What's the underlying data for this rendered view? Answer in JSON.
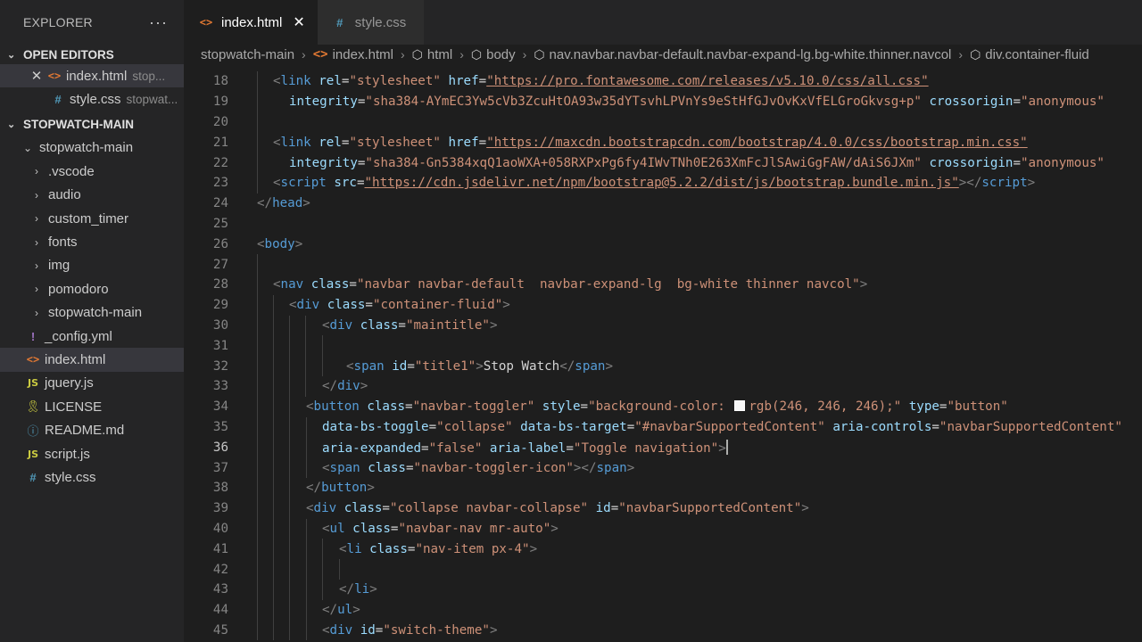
{
  "explorer": {
    "title": "EXPLORER",
    "more": "···",
    "open_editors": {
      "label": "OPEN EDITORS",
      "items": [
        {
          "name": "index.html",
          "sub": "stop..."
        },
        {
          "name": "style.css",
          "sub": "stopwat..."
        }
      ]
    },
    "workspace": {
      "label": "STOPWATCH-MAIN",
      "folder": "stopwatch-main",
      "items": [
        ".vscode",
        "audio",
        "custom_timer",
        "fonts",
        "img",
        "pomodoro",
        "stopwatch-main",
        "_config.yml",
        "index.html",
        "jquery.js",
        "LICENSE",
        "README.md",
        "script.js",
        "style.css"
      ]
    }
  },
  "tabs": [
    {
      "label": "index.html",
      "close": "✕"
    },
    {
      "label": "style.css"
    }
  ],
  "breadcrumb": [
    "stopwatch-main",
    "index.html",
    "html",
    "body",
    "nav.navbar.navbar-default.navbar-expand-lg.bg-white.thinner.navcol",
    "div.container-fluid"
  ],
  "editor": {
    "current_line": 36,
    "lines": [
      {
        "n": "18",
        "p1": "<",
        "t1": "link",
        "a1": " rel",
        "e1": "=",
        "s1": "\"stylesheet\"",
        "a2": " href",
        "e2": "=",
        "s2": "\"https://pro.fontawesome.com/releases/v5.10.0/css/all.css\""
      },
      {
        "n": "19",
        "a1": "integrity",
        "e1": "=",
        "s1": "\"sha384-AYmEC3Yw5cVb3ZcuHtOA93w35dYTsvhLPVnYs9eStHfGJvOvKxVfELGroGkvsg+p\"",
        "a2": " crossorigin",
        "e2": "=",
        "s2": "\"anonymous\""
      },
      {
        "n": "20"
      },
      {
        "n": "21",
        "p1": "<",
        "t1": "link",
        "a1": " rel",
        "e1": "=",
        "s1": "\"stylesheet\"",
        "a2": " href",
        "e2": "=",
        "s2": "\"https://maxcdn.bootstrapcdn.com/bootstrap/4.0.0/css/bootstrap.min.css\""
      },
      {
        "n": "22",
        "a1": "integrity",
        "e1": "=",
        "s1": "\"sha384-Gn5384xqQ1aoWXA+058RXPxPg6fy4IWvTNh0E263XmFcJlSAwiGgFAW/dAiS6JXm\"",
        "a2": " crossorigin",
        "e2": "=",
        "s2": "\"anonymous\""
      },
      {
        "n": "23",
        "p1": "<",
        "t1": "script",
        "a1": " src",
        "e1": "=",
        "s1": "\"https://cdn.jsdelivr.net/npm/bootstrap@5.2.2/dist/js/bootstrap.bundle.min.js\"",
        "p2": "></",
        "t2": "script",
        "p3": ">"
      },
      {
        "n": "24",
        "p1": "</",
        "t1": "head",
        "p2": ">"
      },
      {
        "n": "25"
      },
      {
        "n": "26",
        "p1": "<",
        "t1": "body",
        "p2": ">"
      },
      {
        "n": "27"
      },
      {
        "n": "28",
        "p1": "<",
        "t1": "nav",
        "a1": " class",
        "e1": "=",
        "s1": "\"navbar navbar-default  navbar-expand-lg  bg-white thinner navcol\"",
        "p2": ">"
      },
      {
        "n": "29",
        "p1": "<",
        "t1": "div",
        "a1": " class",
        "e1": "=",
        "s1": "\"container-fluid\"",
        "p2": ">"
      },
      {
        "n": "30",
        "p1": "<",
        "t1": "div",
        "a1": " class",
        "e1": "=",
        "s1": "\"maintitle\"",
        "p2": ">"
      },
      {
        "n": "31"
      },
      {
        "n": "32",
        "p1": "<",
        "t1": "span",
        "a1": " id",
        "e1": "=",
        "s1": "\"title1\"",
        "p2": ">",
        "x1": "Stop Watch",
        "p3": "</",
        "t2": "span",
        "p4": ">"
      },
      {
        "n": "33",
        "p1": "</",
        "t1": "div",
        "p2": ">"
      },
      {
        "n": "34",
        "p1": "<",
        "t1": "button",
        "a1": " class",
        "e1": "=",
        "s1": "\"navbar-toggler\"",
        "a2": " style",
        "e2": "=",
        "s2a": "\"background-color: ",
        "s2b": "rgb(246, 246, 246);\"",
        "a3": " type",
        "e3": "=",
        "s3": "\"button\""
      },
      {
        "n": "35",
        "a1": "data-bs-toggle",
        "e1": "=",
        "s1": "\"collapse\"",
        "a2": " data-bs-target",
        "e2": "=",
        "s2": "\"#navbarSupportedContent\"",
        "a3": " aria-controls",
        "e3": "=",
        "s3": "\"navbarSupportedContent\""
      },
      {
        "n": "36",
        "a1": "aria-expanded",
        "e1": "=",
        "s1": "\"false\"",
        "a2": " aria-label",
        "e2": "=",
        "s2": "\"Toggle navigation\"",
        "p2": ">"
      },
      {
        "n": "37",
        "p1": "<",
        "t1": "span",
        "a1": " class",
        "e1": "=",
        "s1": "\"navbar-toggler-icon\"",
        "p2": "></",
        "t2": "span",
        "p3": ">"
      },
      {
        "n": "38",
        "p1": "</",
        "t1": "button",
        "p2": ">"
      },
      {
        "n": "39",
        "p1": "<",
        "t1": "div",
        "a1": " class",
        "e1": "=",
        "s1": "\"collapse navbar-collapse\"",
        "a2": " id",
        "e2": "=",
        "s2": "\"navbarSupportedContent\"",
        "p2": ">"
      },
      {
        "n": "40",
        "p1": "<",
        "t1": "ul",
        "a1": " class",
        "e1": "=",
        "s1": "\"navbar-nav mr-auto\"",
        "p2": ">"
      },
      {
        "n": "41",
        "p1": "<",
        "t1": "li",
        "a1": " class",
        "e1": "=",
        "s1": "\"nav-item px-4\"",
        "p2": ">"
      },
      {
        "n": "42"
      },
      {
        "n": "43",
        "p1": "</",
        "t1": "li",
        "p2": ">"
      },
      {
        "n": "44",
        "p1": "</",
        "t1": "ul",
        "p2": ">"
      },
      {
        "n": "45",
        "p1": "<",
        "t1": "div",
        "a1": " id",
        "e1": "=",
        "s1": "\"switch-theme\"",
        "p2": ">"
      }
    ]
  }
}
